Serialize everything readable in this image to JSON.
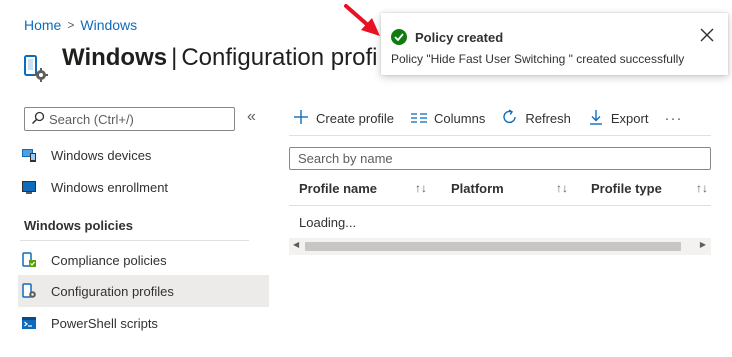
{
  "breadcrumb": {
    "home": "Home",
    "separator": ">",
    "current": "Windows"
  },
  "header": {
    "title_bold": "Windows",
    "separator": "|",
    "title_rest": "Configuration profi"
  },
  "sidebar": {
    "search_placeholder": "Search (Ctrl+/)",
    "collapse_glyph": "«",
    "items_top": [
      {
        "label": "Windows devices",
        "icon": "devices-icon"
      },
      {
        "label": "Windows enrollment",
        "icon": "enrollment-icon"
      }
    ],
    "section_heading": "Windows policies",
    "items_policies": [
      {
        "label": "Compliance policies",
        "icon": "compliance-icon"
      },
      {
        "label": "Configuration profiles",
        "icon": "configuration-icon",
        "active": true
      },
      {
        "label": "PowerShell scripts",
        "icon": "powershell-icon"
      }
    ]
  },
  "toolbar": {
    "create_profile": "Create profile",
    "columns": "Columns",
    "refresh": "Refresh",
    "export": "Export",
    "more": "···"
  },
  "filter": {
    "placeholder": "Search by name"
  },
  "table": {
    "columns": [
      "Profile name",
      "Platform",
      "Profile type"
    ],
    "sort_glyph": "↑↓",
    "loading_text": "Loading..."
  },
  "toast": {
    "title": "Policy created",
    "message": "Policy \"Hide Fast User Switching \" created successfully",
    "status_color": "#107c10"
  },
  "colors": {
    "accent": "#0f6cbd",
    "annotation_arrow": "#e81123"
  }
}
